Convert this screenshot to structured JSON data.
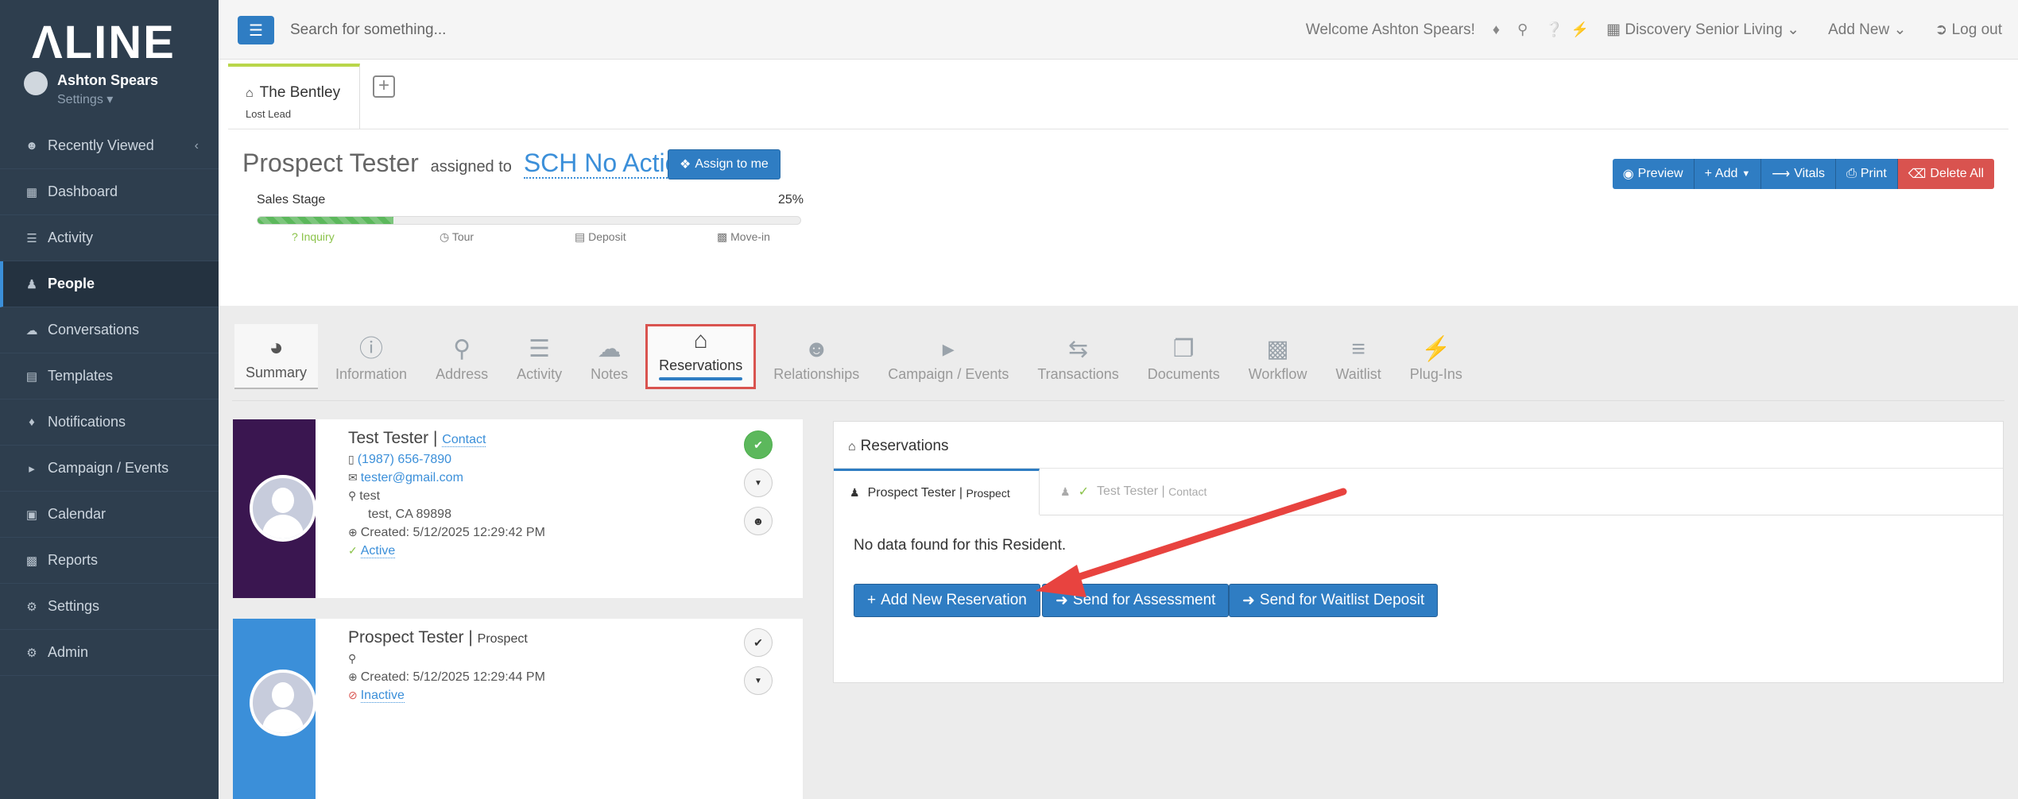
{
  "brand": {
    "logo": "ΛLINE"
  },
  "user": {
    "name": "Ashton Spears",
    "settings": "Settings ▾"
  },
  "sidebar": {
    "items": [
      {
        "label": "Recently Viewed",
        "icon": "users-icon"
      },
      {
        "label": "Dashboard",
        "icon": "dashboard-icon"
      },
      {
        "label": "Activity",
        "icon": "list-icon"
      },
      {
        "label": "People",
        "icon": "person-icon"
      },
      {
        "label": "Conversations",
        "icon": "chat-icon"
      },
      {
        "label": "Templates",
        "icon": "file-icon"
      },
      {
        "label": "Notifications",
        "icon": "bell-icon"
      },
      {
        "label": "Campaign / Events",
        "icon": "megaphone-icon"
      },
      {
        "label": "Calendar",
        "icon": "calendar-icon"
      },
      {
        "label": "Reports",
        "icon": "bar-chart-icon"
      },
      {
        "label": "Settings",
        "icon": "gear-icon"
      },
      {
        "label": "Admin",
        "icon": "cogs-icon"
      }
    ]
  },
  "topbar": {
    "search_placeholder": "Search for something...",
    "welcome": "Welcome Ashton Spears!",
    "community": "Discovery Senior Living",
    "add_new": "Add New",
    "logout": "Log out"
  },
  "record_tab": {
    "title": "The Bentley",
    "subtitle": "Lost Lead"
  },
  "prospect": {
    "name": "Prospect Tester",
    "assigned_to": "assigned to",
    "assignee": "SCH No Action",
    "assign_button": "Assign to me"
  },
  "sales_stage": {
    "label": "Sales Stage",
    "percent_text": "25%",
    "progress": 0.25,
    "stages": [
      "Inquiry",
      "Tour",
      "Deposit",
      "Move-in"
    ]
  },
  "actions": {
    "preview": "Preview",
    "add": "Add",
    "vitals": "Vitals",
    "print": "Print",
    "delete_all": "Delete All"
  },
  "sections": [
    "Summary",
    "Information",
    "Address",
    "Activity",
    "Notes",
    "Reservations",
    "Relationships",
    "Campaign / Events",
    "Transactions",
    "Documents",
    "Workflow",
    "Waitlist",
    "Plug-Ins"
  ],
  "contacts": [
    {
      "name": "Test Tester",
      "type": "Contact",
      "phone": "(1987) 656-7890",
      "email": "tester@gmail.com",
      "address1": "test",
      "address2": "test, CA 89898",
      "created": "Created: 5/12/2025 12:29:42 PM",
      "status": "Active",
      "band_color": "#3a1650"
    },
    {
      "name": "Prospect Tester",
      "type": "Prospect",
      "created": "Created: 5/12/2025 12:29:44 PM",
      "status": "Inactive",
      "band_color": "#3b8fd9"
    }
  ],
  "reservations": {
    "title": "Reservations",
    "tab_active_name": "Prospect Tester",
    "tab_active_type": "Prospect",
    "tab_other_name": "Test Tester",
    "tab_other_type": "Contact",
    "no_data": "No data found for this Resident.",
    "buttons": {
      "add": "Add New Reservation",
      "assessment": "Send for Assessment",
      "waitlist": "Send for Waitlist Deposit"
    }
  },
  "colors": {
    "primary": "#2f7dc3",
    "danger": "#d9534f",
    "sidebar": "#2e3e4e",
    "annotation": "#e8433f"
  }
}
